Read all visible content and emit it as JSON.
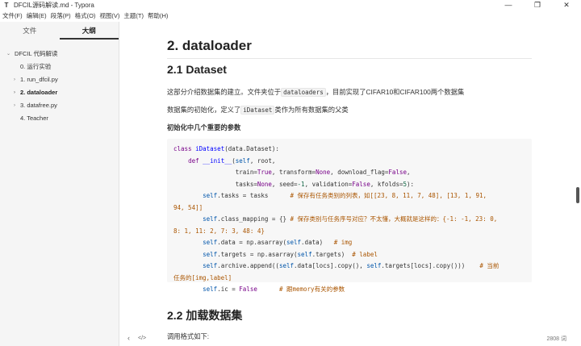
{
  "window": {
    "app_icon": "T",
    "title": "DFCIL源码解读.md - Typora",
    "minimize": "—",
    "maximize": "❐",
    "close": "✕"
  },
  "menu": [
    "文件(F)",
    "编辑(E)",
    "段落(P)",
    "格式(O)",
    "视图(V)",
    "主题(T)",
    "帮助(H)"
  ],
  "sidebar": {
    "tabs": [
      "文件",
      "大纲"
    ],
    "active_tab": "大纲",
    "outline": [
      {
        "label": "DFCIL 代码解读",
        "caret": "⌄",
        "bold": false
      },
      {
        "label": "0. 运行实验",
        "caret": "",
        "bold": false
      },
      {
        "label": "1. run_dfcil.py",
        "caret": "›",
        "bold": false
      },
      {
        "label": "2. dataloader",
        "caret": "›",
        "bold": true
      },
      {
        "label": "3. datafree.py",
        "caret": "›",
        "bold": false
      },
      {
        "label": "4. Teacher",
        "caret": "",
        "bold": false
      }
    ],
    "back_icon": "‹",
    "source_icon": "</>"
  },
  "doc": {
    "h1": "2. dataloader",
    "h2_1": "2.1 Dataset",
    "p1_pre": "这部分介绍数据集的建立。文件夹位于",
    "p1_code": "dataloaders",
    "p1_post": "，目前实现了CIFAR10和CIFAR100两个数据集",
    "p2_pre": "数据集的初始化，定义了",
    "p2_code": "iDataset",
    "p2_post": "类作为所有数据集的父类",
    "p3": "初始化中几个重要的参数",
    "h2_2": "2.2 加载数据集",
    "p4": "调用格式如下:"
  },
  "code_lines": [
    [
      [
        "kw",
        "class "
      ],
      [
        "df",
        "iDataset"
      ],
      [
        "op",
        "(data.Dataset):"
      ]
    ],
    [
      [
        "op",
        "    "
      ],
      [
        "kw",
        "def "
      ],
      [
        "df",
        "__init__"
      ],
      [
        "op",
        "("
      ],
      [
        "var",
        "self"
      ],
      [
        "op",
        ", root,"
      ]
    ],
    [
      [
        "op",
        "                 train="
      ],
      [
        "kw",
        "True"
      ],
      [
        "op",
        ", transform="
      ],
      [
        "kw",
        "None"
      ],
      [
        "op",
        ", download_flag="
      ],
      [
        "kw",
        "False"
      ],
      [
        "op",
        ","
      ]
    ],
    [
      [
        "op",
        "                 tasks="
      ],
      [
        "kw",
        "None"
      ],
      [
        "op",
        ", seed="
      ],
      [
        "num",
        "-1"
      ],
      [
        "op",
        ", validation="
      ],
      [
        "kw",
        "False"
      ],
      [
        "op",
        ", kfolds="
      ],
      [
        "num",
        "5"
      ],
      [
        "op",
        "):"
      ]
    ],
    [
      [
        "op",
        "        "
      ],
      [
        "var",
        "self"
      ],
      [
        "op",
        ".tasks = tasks      "
      ],
      [
        "cm",
        "# 保存有任务类别的列表，如[[23, 8, 11, 7, 48], [13, 1, 91,"
      ]
    ],
    [
      [
        "cm",
        "94, 54]]"
      ]
    ],
    [
      [
        "op",
        "        "
      ],
      [
        "var",
        "self"
      ],
      [
        "op",
        ".class_mapping = {} "
      ],
      [
        "cm",
        "# 保存类别与任务序号对应？不太懂，大概就是这样的：{-1: -1, 23: 0,"
      ]
    ],
    [
      [
        "cm",
        "8: 1, 11: 2, 7: 3, 48: 4}"
      ]
    ],
    [
      [
        "op",
        "        "
      ],
      [
        "var",
        "self"
      ],
      [
        "op",
        ".data = np.asarray("
      ],
      [
        "var",
        "self"
      ],
      [
        "op",
        ".data)   "
      ],
      [
        "cm",
        "# img"
      ]
    ],
    [
      [
        "op",
        "        "
      ],
      [
        "var",
        "self"
      ],
      [
        "op",
        ".targets = np.asarray("
      ],
      [
        "var",
        "self"
      ],
      [
        "op",
        ".targets)  "
      ],
      [
        "cm",
        "# label"
      ]
    ],
    [
      [
        "op",
        "        "
      ],
      [
        "var",
        "self"
      ],
      [
        "op",
        ".archive.append(("
      ],
      [
        "var",
        "self"
      ],
      [
        "op",
        ".data[locs].copy(), "
      ],
      [
        "var",
        "self"
      ],
      [
        "op",
        ".targets[locs].copy()))    "
      ],
      [
        "cm",
        "# 当前"
      ]
    ],
    [
      [
        "cm",
        "任务的[img,label]"
      ]
    ],
    [
      [
        "op",
        "        "
      ],
      [
        "var",
        "self"
      ],
      [
        "op",
        ".ic = "
      ],
      [
        "kw",
        "False"
      ],
      [
        "op",
        "      "
      ],
      [
        "cm",
        "# 跟memory有关的参数"
      ]
    ]
  ],
  "status": {
    "word_count": "2808 词"
  }
}
